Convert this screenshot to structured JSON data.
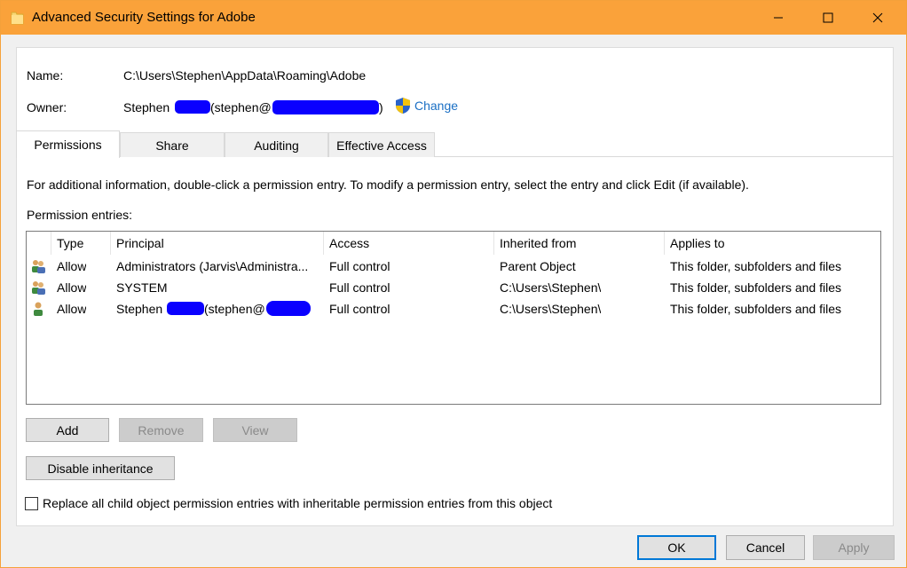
{
  "window": {
    "title": "Advanced Security Settings for Adobe"
  },
  "info": {
    "name_label": "Name:",
    "name_value": "C:\\Users\\Stephen\\AppData\\Roaming\\Adobe",
    "owner_label": "Owner:",
    "owner_value_prefix": "Stephen",
    "owner_value_mid": "(stephen@",
    "owner_value_suffix": ")",
    "change_label": "Change"
  },
  "tabs": [
    {
      "label": "Permissions",
      "active": true
    },
    {
      "label": "Share",
      "active": false
    },
    {
      "label": "Auditing",
      "active": false
    },
    {
      "label": "Effective Access",
      "active": false
    }
  ],
  "permissions": {
    "description": "For additional information, double-click a permission entry. To modify a permission entry, select the entry and click Edit (if available).",
    "entries_label": "Permission entries:",
    "columns": [
      "Type",
      "Principal",
      "Access",
      "Inherited from",
      "Applies to"
    ],
    "rows": [
      {
        "icon": "users-group-icon",
        "type": "Allow",
        "principal": "Administrators (Jarvis\\Administra...",
        "access": "Full control",
        "inherited": "Parent Object",
        "applies": "This folder, subfolders and files"
      },
      {
        "icon": "users-group-icon",
        "type": "Allow",
        "principal": "SYSTEM",
        "access": "Full control",
        "inherited": "C:\\Users\\Stephen\\",
        "applies": "This folder, subfolders and files"
      },
      {
        "icon": "user-icon",
        "type": "Allow",
        "principal_prefix": "Stephen",
        "principal_mid": "(stephen@",
        "access": "Full control",
        "inherited": "C:\\Users\\Stephen\\",
        "applies": "This folder, subfolders and files"
      }
    ]
  },
  "buttons": {
    "add": "Add",
    "remove": "Remove",
    "view": "View",
    "disable_inheritance": "Disable inheritance",
    "ok": "OK",
    "cancel": "Cancel",
    "apply": "Apply"
  },
  "replace_checkbox": {
    "label": "Replace all child object permission entries with inheritable permission entries from this object",
    "checked": false
  },
  "colors": {
    "titlebar": "#faa23a",
    "link": "#1a6fc4",
    "redaction": "#0a00ff",
    "focus": "#0078d7"
  }
}
